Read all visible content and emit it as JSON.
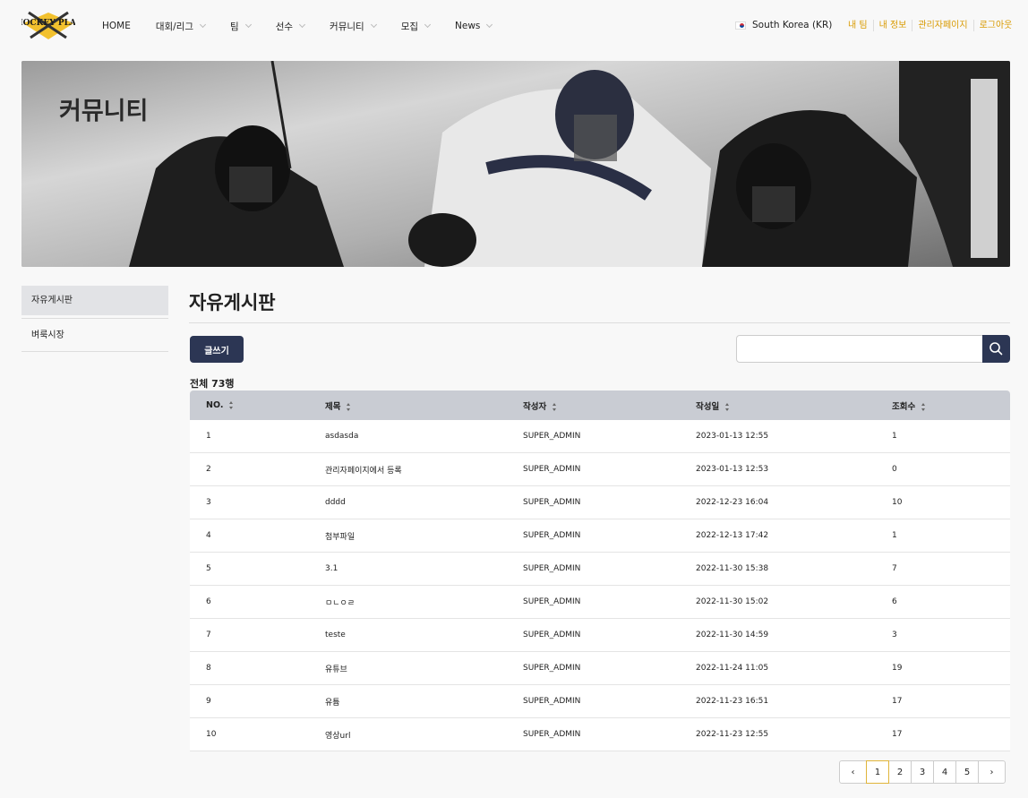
{
  "header": {
    "logo_text": "HOCKEY PLAY",
    "nav": [
      {
        "label": "HOME",
        "dropdown": false
      },
      {
        "label": "대회/리그",
        "dropdown": true
      },
      {
        "label": "팀",
        "dropdown": true
      },
      {
        "label": "선수",
        "dropdown": true
      },
      {
        "label": "커뮤니티",
        "dropdown": true
      },
      {
        "label": "모집",
        "dropdown": true
      },
      {
        "label": "News",
        "dropdown": true
      }
    ],
    "country": "South Korea (KR)",
    "user_links": [
      "내 팀",
      "내 정보",
      "관리자페이지",
      "로그아웃"
    ]
  },
  "banner": {
    "title": "커뮤니티"
  },
  "sidebar": {
    "items": [
      {
        "label": "자유게시판",
        "active": true
      },
      {
        "label": "벼룩시장",
        "active": false
      }
    ]
  },
  "main": {
    "title": "자유게시판",
    "write_button": "글쓰기",
    "search_placeholder": "",
    "total": "전체 73행"
  },
  "table": {
    "columns": [
      "NO.",
      "제목",
      "작성자",
      "작성일",
      "조회수"
    ],
    "rows": [
      [
        "1",
        "asdasda",
        "SUPER_ADMIN",
        "2023-01-13 12:55",
        "1"
      ],
      [
        "2",
        "관리자페이지에서 등록",
        "SUPER_ADMIN",
        "2023-01-13 12:53",
        "0"
      ],
      [
        "3",
        "dddd",
        "SUPER_ADMIN",
        "2022-12-23 16:04",
        "10"
      ],
      [
        "4",
        "첨부파일",
        "SUPER_ADMIN",
        "2022-12-13 17:42",
        "1"
      ],
      [
        "5",
        "3.1",
        "SUPER_ADMIN",
        "2022-11-30 15:38",
        "7"
      ],
      [
        "6",
        "ㅁㄴㅇㄹ",
        "SUPER_ADMIN",
        "2022-11-30 15:02",
        "6"
      ],
      [
        "7",
        "teste",
        "SUPER_ADMIN",
        "2022-11-30 14:59",
        "3"
      ],
      [
        "8",
        "유튜브",
        "SUPER_ADMIN",
        "2022-11-24 11:05",
        "19"
      ],
      [
        "9",
        "유튬",
        "SUPER_ADMIN",
        "2022-11-23 16:51",
        "17"
      ],
      [
        "10",
        "영상url",
        "SUPER_ADMIN",
        "2022-11-23 12:55",
        "17"
      ]
    ]
  },
  "pagination": {
    "prev": "‹",
    "next": "›",
    "pages": [
      "1",
      "2",
      "3",
      "4",
      "5"
    ],
    "current": "1"
  },
  "colors": {
    "primary": "#2c3654",
    "accent": "#d99a00",
    "header_bg": "#c9ccd3"
  }
}
